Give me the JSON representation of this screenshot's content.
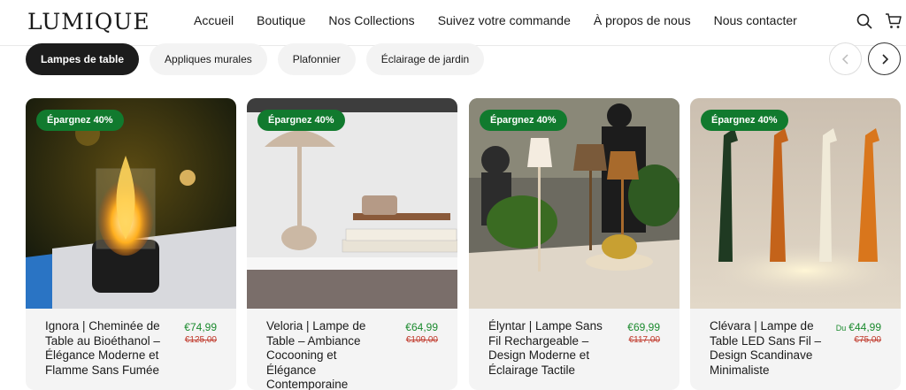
{
  "header": {
    "logo": "LUMIQUE",
    "nav": [
      "Accueil",
      "Boutique",
      "Nos Collections",
      "Suivez votre commande",
      "À propos de nous",
      "Nous contacter"
    ]
  },
  "icons": {
    "search": "search-icon",
    "cart": "cart-icon",
    "prev": "chevron-left-icon",
    "next": "chevron-right-icon"
  },
  "categories": [
    "Lampes de table",
    "Appliques murales",
    "Plafonnier",
    "Éclairage de jardin"
  ],
  "active_category": "Lampes de table",
  "colors": {
    "badge": "#117a2e",
    "price": "#1b8a2e",
    "old_price": "#c0392b",
    "active_pill": "#1c1c1c"
  },
  "products": [
    {
      "badge": "Épargnez 40%",
      "name": "Ignora | Cheminée de Table au Bioéthanol – Élégance Moderne et Flamme Sans Fumée",
      "price_prefix": "",
      "price": "€74,99",
      "old_price": "€125,00"
    },
    {
      "badge": "Épargnez 40%",
      "name": "Veloria | Lampe de Table – Ambiance Cocooning et Élégance Contemporaine",
      "price_prefix": "",
      "price": "€64,99",
      "old_price": "€109,00"
    },
    {
      "badge": "Épargnez 40%",
      "name": "Élyntar | Lampe Sans Fil Rechargeable – Design Moderne et Éclairage Tactile",
      "price_prefix": "",
      "price": "€69,99",
      "old_price": "€117,00"
    },
    {
      "badge": "Épargnez 40%",
      "name": "Clévara | Lampe de Table LED Sans Fil – Design Scandinave Minimaliste",
      "price_prefix": "Du",
      "price": "€44,99",
      "old_price": "€75,00"
    }
  ]
}
